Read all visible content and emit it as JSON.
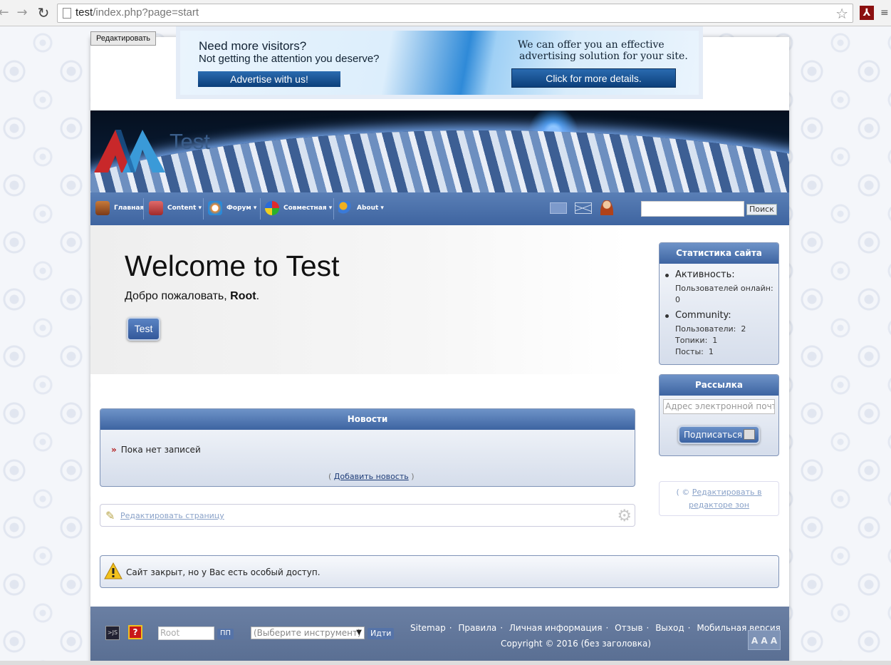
{
  "browser": {
    "url_host": "test",
    "url_path": "/index.php?page=start"
  },
  "admin": {
    "edit_label": "Редактировать"
  },
  "ad": {
    "headline": "Need more visitors?",
    "subline": "Not getting the attention you deserve?",
    "button_left": "Advertise with us!",
    "right_line1": "We can offer you an effective",
    "right_line2": "advertising solution for your site.",
    "button_right": "Click for more details."
  },
  "header": {
    "site_name": "Test"
  },
  "nav": {
    "items": [
      {
        "label": "Главная",
        "icon": "home-icon"
      },
      {
        "label": "Content ▾",
        "icon": "content-icon"
      },
      {
        "label": "Форум ▾",
        "icon": "forum-icon"
      },
      {
        "label": "Совместная ▾",
        "icon": "puzzle-icon"
      },
      {
        "label": "About ▾",
        "icon": "about-icon"
      }
    ],
    "search_button": "Поиск"
  },
  "welcome": {
    "title": "Welcome to Test",
    "greeting_prefix": "Добро пожаловать, ",
    "greeting_user": "Root",
    "greeting_suffix": ".",
    "button": "Test"
  },
  "news": {
    "title": "Новости",
    "empty": "Пока нет записей",
    "add_link": "Добавить новость"
  },
  "edit_page": {
    "link": "Редактировать страницу"
  },
  "notice": {
    "text": "Сайт закрыт, но у Вас есть особый доступ."
  },
  "stats": {
    "title": "Статистика сайта",
    "activity_label": "Активность:",
    "online_label": "Пользователей онлайн:",
    "online_value": "0",
    "community_label": "Community:",
    "users_label": "Пользователи:",
    "users_value": "2",
    "topics_label": "Топики:",
    "topics_value": "1",
    "posts_label": "Посты:",
    "posts_value": "1"
  },
  "mailing": {
    "title": "Рассылка",
    "placeholder": "Адрес электронной почты",
    "button": "Подписаться"
  },
  "zone_edit": {
    "line1": "Редактировать в",
    "line2": "редакторе зон"
  },
  "footer": {
    "js_label": ">JS",
    "help_label": "?",
    "login_value": "Root",
    "pp_label": "ПП",
    "tool_select": "(Выберите инструмент)",
    "go_label": "Идти",
    "links": [
      "Sitemap",
      "Правила",
      "Личная информация",
      "Отзыв",
      "Выход",
      "Мобильная версия"
    ],
    "copyright": "Copyright © 2016 (без заголовка)",
    "font_size_label": "A A A"
  },
  "colors": {
    "nav_blue": "#3e64a0",
    "block_border": "#7f93b7",
    "footer_bg": "#5a6f93",
    "link_blue": "#1f3d78"
  }
}
